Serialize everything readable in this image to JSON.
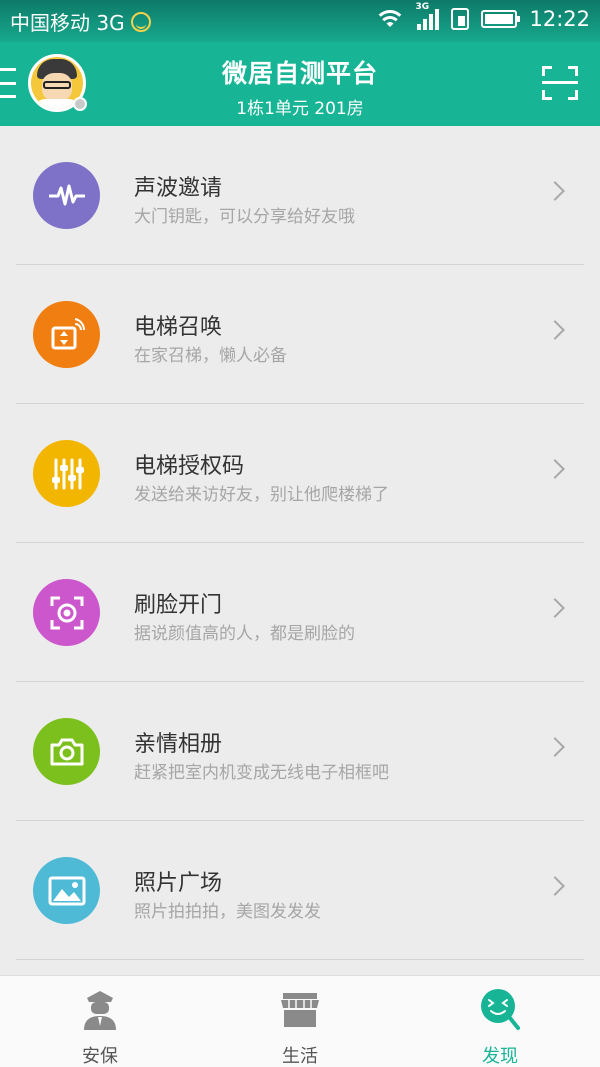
{
  "status_bar": {
    "carrier": "中国移动 3G",
    "network_tag": "3G",
    "time": "12:22"
  },
  "header": {
    "title": "微居自测平台",
    "subtitle": "1栋1单元 201房"
  },
  "list": [
    {
      "title": "声波邀请",
      "desc": "大门钥匙，可以分享给好友哦",
      "icon": "sound-wave-icon",
      "color": "#7e72c8"
    },
    {
      "title": "电梯召唤",
      "desc": "在家召梯，懒人必备",
      "icon": "elevator-call-icon",
      "color": "#f07e10"
    },
    {
      "title": "电梯授权码",
      "desc": "发送给来访好友，别让他爬楼梯了",
      "icon": "sliders-icon",
      "color": "#f2b600"
    },
    {
      "title": "刷脸开门",
      "desc": "据说颜值高的人，都是刷脸的",
      "icon": "face-scan-icon",
      "color": "#cc56cc"
    },
    {
      "title": "亲情相册",
      "desc": "赶紧把室内机变成无线电子相框吧",
      "icon": "camera-icon",
      "color": "#7cc01e"
    },
    {
      "title": "照片广场",
      "desc": "照片拍拍拍，美图发发发",
      "icon": "image-icon",
      "color": "#4fbad6"
    }
  ],
  "tabs": [
    {
      "label": "安保",
      "icon": "guard-icon",
      "active": false
    },
    {
      "label": "生活",
      "icon": "shop-icon",
      "active": false
    },
    {
      "label": "发现",
      "icon": "discover-icon",
      "active": true
    }
  ],
  "colors": {
    "brand": "#17b596",
    "active_tab": "#17b596"
  }
}
